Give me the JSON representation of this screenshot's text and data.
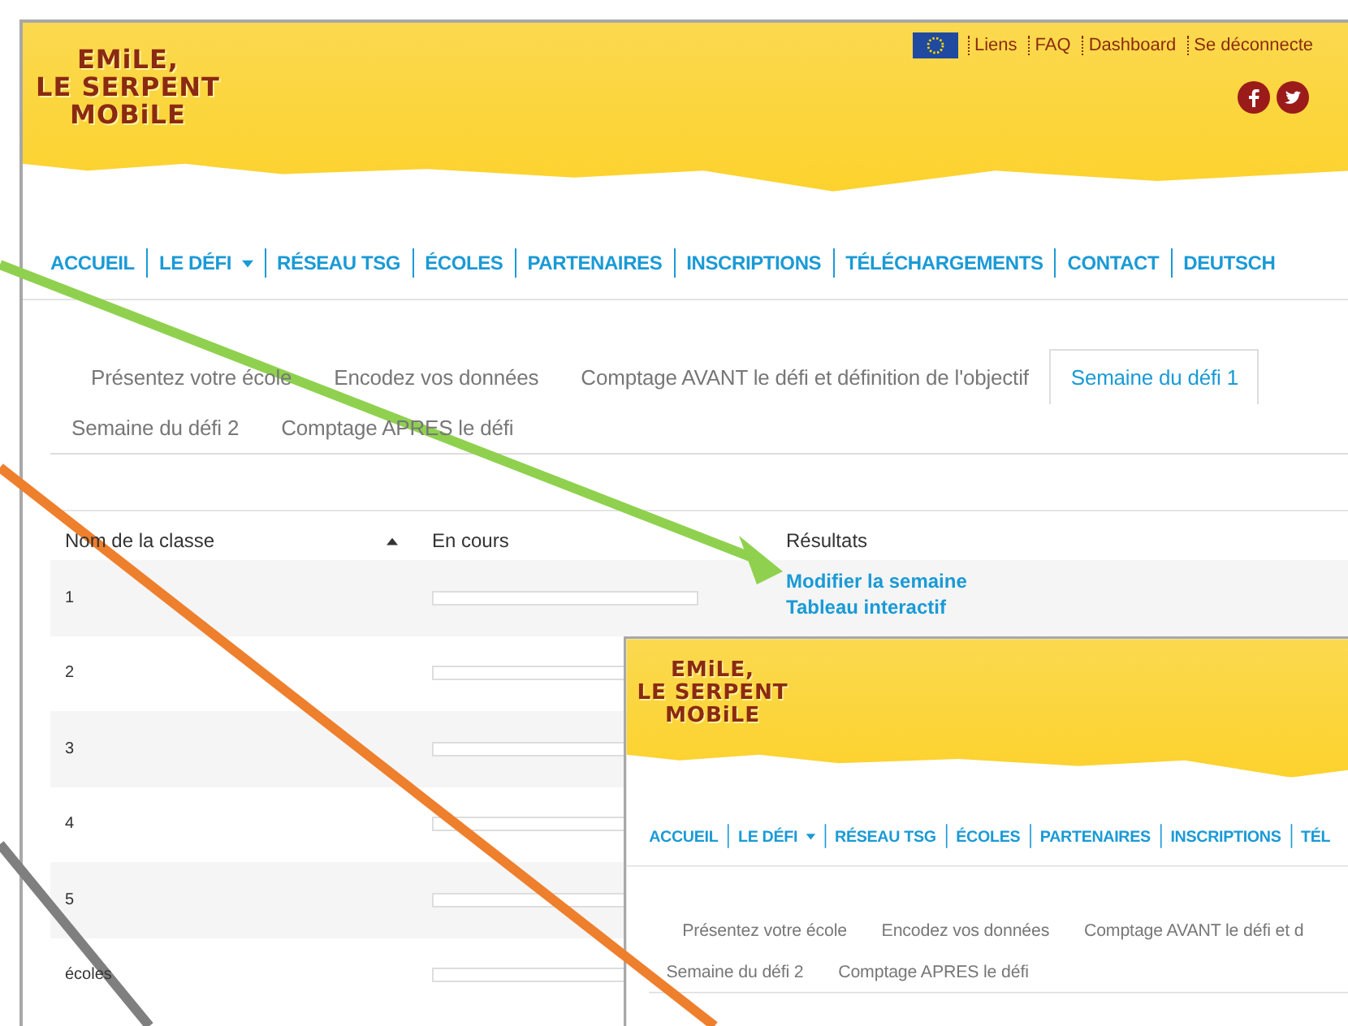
{
  "pages": [
    {
      "logo": "EMiLE,\nLE SERPENT\nMOBiLE",
      "top_links": [
        "Liens",
        "FAQ",
        "Dashboard",
        "Se déconnecte"
      ],
      "nav": [
        {
          "label": "ACCUEIL",
          "dropdown": false
        },
        {
          "label": "LE DÉFI",
          "dropdown": true
        },
        {
          "label": "RÉSEAU TSG",
          "dropdown": false
        },
        {
          "label": "ÉCOLES",
          "dropdown": false
        },
        {
          "label": "PARTENAIRES",
          "dropdown": false
        },
        {
          "label": "INSCRIPTIONS",
          "dropdown": false
        },
        {
          "label": "TÉLÉCHARGEMENTS",
          "dropdown": false
        },
        {
          "label": "CONTACT",
          "dropdown": false
        },
        {
          "label": "DEUTSCH",
          "dropdown": false
        }
      ],
      "tabs": [
        [
          {
            "label": "Présentez votre école",
            "selected": false
          },
          {
            "label": "Encodez vos données",
            "selected": false
          },
          {
            "label": "Comptage AVANT le défi et définition de l'objectif",
            "selected": false
          },
          {
            "label": "Semaine du défi 1",
            "selected": true
          }
        ],
        [
          {
            "label": "Semaine du défi 2",
            "selected": false
          },
          {
            "label": "Comptage APRES le défi",
            "selected": false
          }
        ]
      ],
      "table": {
        "columns": [
          {
            "label": "Nom de la classe",
            "sorted": true
          },
          {
            "label": "En cours",
            "sorted": false
          },
          {
            "label": "Résultats",
            "sorted": false
          }
        ],
        "rows": [
          {
            "name": "1",
            "level": 0,
            "links": [
              "Modifier la semaine",
              "Tableau interactif"
            ]
          },
          {
            "name": "2",
            "level": 0,
            "links": []
          },
          {
            "name": "3",
            "level": 0,
            "links": []
          },
          {
            "name": "4",
            "level": 0,
            "links": []
          },
          {
            "name": "5",
            "level": 0,
            "links": []
          },
          {
            "name": "écoles",
            "level": 0,
            "links": []
          }
        ]
      }
    },
    {
      "logo": "EMiLE,\nLE SERPENT\nMOBiLE",
      "nav": [
        {
          "label": "ACCUEIL",
          "dropdown": false
        },
        {
          "label": "LE DÉFI",
          "dropdown": true
        },
        {
          "label": "RÉSEAU TSG",
          "dropdown": false
        },
        {
          "label": "ÉCOLES",
          "dropdown": false
        },
        {
          "label": "PARTENAIRES",
          "dropdown": false
        },
        {
          "label": "INSCRIPTIONS",
          "dropdown": false
        },
        {
          "label": "TÉL",
          "dropdown": false
        }
      ],
      "tabs": [
        [
          {
            "label": "Présentez votre école",
            "selected": false
          },
          {
            "label": "Encodez vos données",
            "selected": false
          },
          {
            "label": "Comptage AVANT le défi et d",
            "selected": false
          }
        ],
        [
          {
            "label": "Semaine du défi 2",
            "selected": false
          },
          {
            "label": "Comptage APRES le défi",
            "selected": false
          }
        ]
      ]
    }
  ]
}
